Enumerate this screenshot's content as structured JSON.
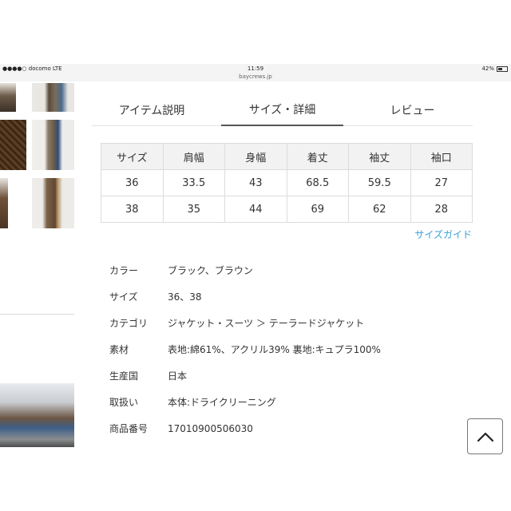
{
  "status_bar": {
    "carrier": "●●●●○ docomo  LTE",
    "time": "11:59",
    "url": "baycrews.jp",
    "battery": "42%"
  },
  "tabs": [
    {
      "label": "アイテム説明"
    },
    {
      "label": "サイズ・詳細"
    },
    {
      "label": "レビュー"
    }
  ],
  "size_table": {
    "headers": [
      "サイズ",
      "肩幅",
      "身幅",
      "着丈",
      "袖丈",
      "袖口"
    ],
    "rows": [
      [
        "36",
        "33.5",
        "43",
        "68.5",
        "59.5",
        "27"
      ],
      [
        "38",
        "35",
        "44",
        "69",
        "62",
        "28"
      ]
    ]
  },
  "size_guide_link": "サイズガイド",
  "specs": [
    {
      "label": "カラー",
      "value": "ブラック、ブラウン"
    },
    {
      "label": "サイズ",
      "value": "36、38"
    },
    {
      "label": "カテゴリ",
      "value": "ジャケット・スーツ ＞ テーラードジャケット"
    },
    {
      "label": "素材",
      "value": "表地:綿61%、アクリル39% 裏地:キュプラ100%"
    },
    {
      "label": "生産国",
      "value": "日本"
    },
    {
      "label": "取扱い",
      "value": "本体:ドライクリーニング"
    },
    {
      "label": "商品番号",
      "value": "17010900506030"
    }
  ],
  "icons": {
    "scroll_top": "chevron-up-icon",
    "battery": "battery-icon"
  }
}
